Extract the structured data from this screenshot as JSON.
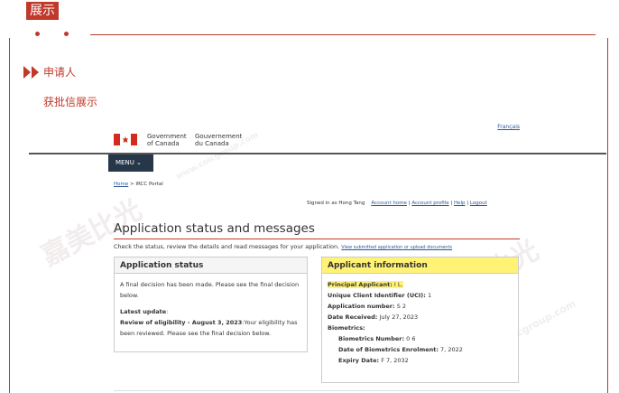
{
  "article": {
    "tag": "展示",
    "section_title": "申请人",
    "subtitle": "获批信展示"
  },
  "watermark": {
    "text_cn": "嘉美比光",
    "text_url": "www.coicgroup.com"
  },
  "header": {
    "language_link": "Français",
    "gov_en_line1": "Government",
    "gov_en_line2": "of Canada",
    "gov_fr_line1": "Gouvernement",
    "gov_fr_line2": "du Canada",
    "menu_label": "MENU ⌄"
  },
  "breadcrumb": {
    "home": "Home",
    "sep": ">",
    "current": "IRCC Portal"
  },
  "signin": {
    "signed_in_as": "Signed in as Hong Tang",
    "account_home": "Account home",
    "account_profile": "Account profile",
    "help": "Help",
    "logout": "Logout",
    "sep": "|"
  },
  "page": {
    "title": "Application status and messages",
    "intro": "Check the status, review the details and read messages for your application.",
    "intro_link": "View submitted application or upload documents"
  },
  "status_panel": {
    "heading": "Application status",
    "decision_text": "A final decision has been made. Please see the final decision below.",
    "latest_update_label": "Latest update",
    "latest_update_colon": ":",
    "review_label": "Review of eligibility - August 3, 2023",
    "review_text": ":Your eligibility has been reviewed. Please see the final decision below."
  },
  "applicant_panel": {
    "heading": "Applicant information",
    "principal_label": "Principal Applicant:",
    "principal_value": "I        L.",
    "uci_label": "Unique Client Identifier (UCI):",
    "uci_value": "1",
    "app_number_label": "Application number:",
    "app_number_value": "S              2",
    "date_received_label": "Date Received:",
    "date_received_value": "July 27, 2023",
    "biometrics_label": "Biometrics:",
    "bio_number_label": "Biometrics Number:",
    "bio_number_value": "0                         6",
    "bio_enrolment_label": "Date of Biometrics Enrolment:",
    "bio_enrolment_value": "          7, 2022",
    "expiry_label": "Expiry Date:",
    "expiry_value": "F              7, 2032"
  },
  "colors": {
    "accent_red": "#c0392b",
    "navy_menu": "#26374a",
    "link_blue": "#2b5797",
    "highlight_yellow": "#fff275"
  }
}
